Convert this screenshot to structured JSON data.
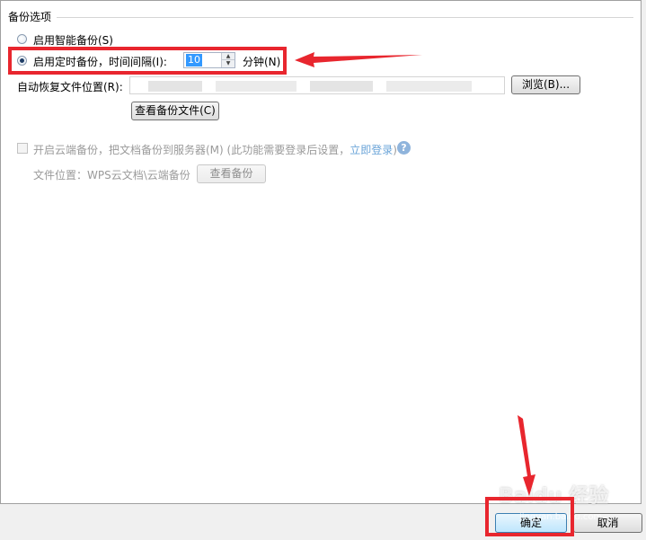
{
  "section": {
    "title": "备份选项"
  },
  "smart_backup": {
    "label": "启用智能备份(S)",
    "checked": false
  },
  "timed_backup": {
    "label": "启用定时备份，时间间隔(I):",
    "checked": true,
    "interval_value": "10",
    "unit_label": "分钟(N)"
  },
  "recovery": {
    "label": "自动恢复文件位置(R):",
    "path_value": "",
    "browse_label": "浏览(B)...",
    "view_files_label": "查看备份文件(C)"
  },
  "cloud": {
    "checkbox_checked": false,
    "label_prefix": "开启云端备份，把文档备份到服务器(M) (此功能需要登录后设置，",
    "login_link": "立即登录",
    "label_suffix": ")",
    "location_label": "文件位置：WPS云文档\\云端备份",
    "view_backup_label": "查看备份"
  },
  "footer": {
    "ok_label": "确定",
    "cancel_label": "取消"
  },
  "watermark": {
    "text": "Baidu 经验",
    "sub": "jingyan.baidu.com"
  },
  "colors": {
    "annotation_red": "#e8262e",
    "selection_blue": "#3399ff",
    "link_blue": "#6aa4d8"
  }
}
